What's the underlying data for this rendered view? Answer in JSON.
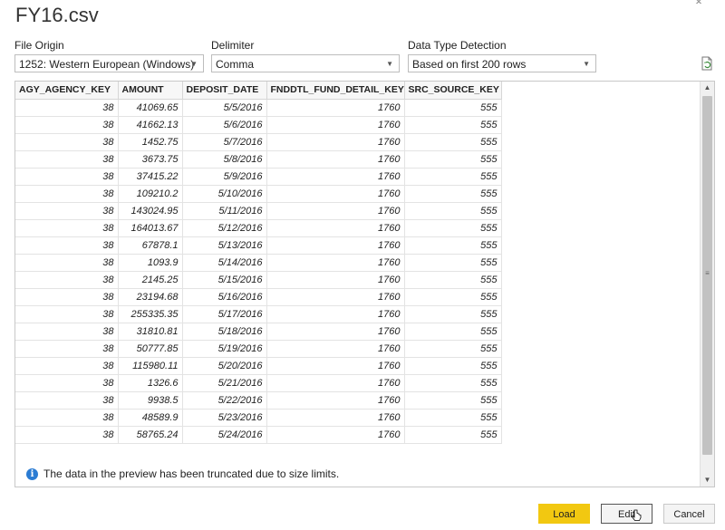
{
  "window": {
    "title": "FY16.csv"
  },
  "options": {
    "file_origin": {
      "label": "File Origin",
      "value": "1252: Western European (Windows)"
    },
    "delimiter": {
      "label": "Delimiter",
      "value": "Comma"
    },
    "detection": {
      "label": "Data Type Detection",
      "value": "Based on first 200 rows"
    }
  },
  "table": {
    "columns": [
      "AGY_AGENCY_KEY",
      "AMOUNT",
      "DEPOSIT_DATE",
      "FNDDTL_FUND_DETAIL_KEY",
      "SRC_SOURCE_KEY"
    ],
    "rows": [
      [
        "38",
        "41069.65",
        "5/5/2016",
        "1760",
        "555"
      ],
      [
        "38",
        "41662.13",
        "5/6/2016",
        "1760",
        "555"
      ],
      [
        "38",
        "1452.75",
        "5/7/2016",
        "1760",
        "555"
      ],
      [
        "38",
        "3673.75",
        "5/8/2016",
        "1760",
        "555"
      ],
      [
        "38",
        "37415.22",
        "5/9/2016",
        "1760",
        "555"
      ],
      [
        "38",
        "109210.2",
        "5/10/2016",
        "1760",
        "555"
      ],
      [
        "38",
        "143024.95",
        "5/11/2016",
        "1760",
        "555"
      ],
      [
        "38",
        "164013.67",
        "5/12/2016",
        "1760",
        "555"
      ],
      [
        "38",
        "67878.1",
        "5/13/2016",
        "1760",
        "555"
      ],
      [
        "38",
        "1093.9",
        "5/14/2016",
        "1760",
        "555"
      ],
      [
        "38",
        "2145.25",
        "5/15/2016",
        "1760",
        "555"
      ],
      [
        "38",
        "23194.68",
        "5/16/2016",
        "1760",
        "555"
      ],
      [
        "38",
        "255335.35",
        "5/17/2016",
        "1760",
        "555"
      ],
      [
        "38",
        "31810.81",
        "5/18/2016",
        "1760",
        "555"
      ],
      [
        "38",
        "50777.85",
        "5/19/2016",
        "1760",
        "555"
      ],
      [
        "38",
        "115980.11",
        "5/20/2016",
        "1760",
        "555"
      ],
      [
        "38",
        "1326.6",
        "5/21/2016",
        "1760",
        "555"
      ],
      [
        "38",
        "9938.5",
        "5/22/2016",
        "1760",
        "555"
      ],
      [
        "38",
        "48589.9",
        "5/23/2016",
        "1760",
        "555"
      ],
      [
        "38",
        "58765.24",
        "5/24/2016",
        "1760",
        "555"
      ]
    ]
  },
  "notice": {
    "text": "The data in the preview has been truncated due to size limits."
  },
  "buttons": {
    "load": "Load",
    "edit": "Edit",
    "cancel": "Cancel"
  },
  "colors": {
    "load_button": "#f2c811",
    "info": "#2b7cd3"
  }
}
